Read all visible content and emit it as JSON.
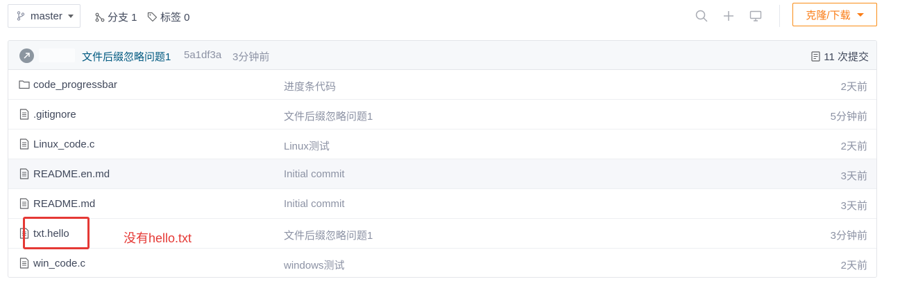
{
  "toolbar": {
    "branch": "master",
    "branches_label": "分支 1",
    "tags_label": "标签 0",
    "clone_label": "克隆/下载"
  },
  "latest_commit": {
    "message": "文件后缀忽略问题1",
    "hash": "5a1df3a",
    "time": "3分钟前",
    "count_label": "11 次提交"
  },
  "files": [
    {
      "icon": "folder-icon",
      "name": "code_progressbar",
      "commit": "进度条代码",
      "time": "2天前"
    },
    {
      "icon": "file-icon",
      "name": ".gitignore",
      "commit": "文件后缀忽略问题1",
      "time": "5分钟前"
    },
    {
      "icon": "file-icon",
      "name": "Linux_code.c",
      "commit": "Linux测试",
      "time": "2天前"
    },
    {
      "icon": "file-icon",
      "name": "README.en.md",
      "commit": "Initial commit",
      "time": "3天前"
    },
    {
      "icon": "file-icon",
      "name": "README.md",
      "commit": "Initial commit",
      "time": "3天前"
    },
    {
      "icon": "file-icon",
      "name": "txt.hello",
      "commit": "文件后缀忽略问题1",
      "time": "3分钟前"
    },
    {
      "icon": "file-icon",
      "name": "win_code.c",
      "commit": "windows测试",
      "time": "2天前"
    }
  ],
  "annotation": {
    "text": "没有hello.txt",
    "color": "#e53935"
  },
  "colors": {
    "accent": "#fa7c16",
    "link": "#005980",
    "muted": "#8c92a4"
  }
}
